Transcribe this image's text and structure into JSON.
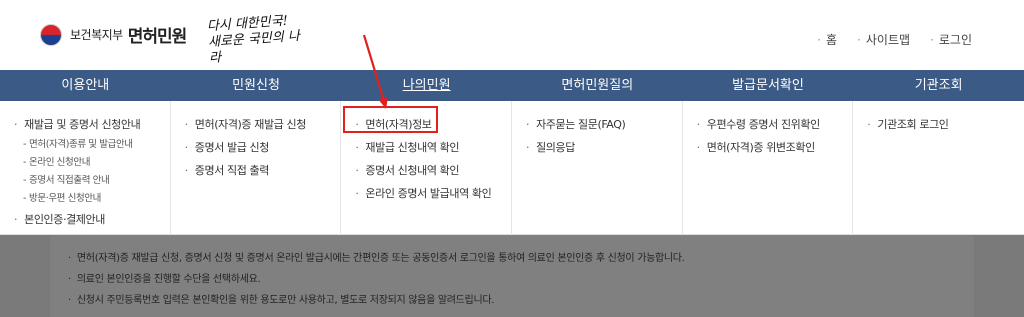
{
  "header": {
    "ministry": "보건복지부",
    "site_name": "면허민원",
    "slogan_line1": "다시 대한민국!",
    "slogan_line2": "새로운 국민의 나라",
    "topnav": [
      "홈",
      "사이트맵",
      "로그인"
    ]
  },
  "gnb": [
    "이용안내",
    "민원신청",
    "나의민원",
    "면허민원질의",
    "발급문서확인",
    "기관조회"
  ],
  "menu": {
    "col1": {
      "item1": "재발급 및 증명서 신청안내",
      "subs": [
        "면허(자격)종류 및 발급안내",
        "온라인 신청안내",
        "증명서 직접출력 안내",
        "방문·우편 신청안내"
      ],
      "item2": "본인인증·결제안내"
    },
    "col2": [
      "면허(자격)증 재발급 신청",
      "증명서 발급 신청",
      "증명서 직접 출력"
    ],
    "col3": [
      "면허(자격)정보",
      "재발급 신청내역 확인",
      "증명서 신청내역 확인",
      "온라인 증명서 발급내역 확인"
    ],
    "col4": [
      "자주묻는 질문(FAQ)",
      "질의응답"
    ],
    "col5": [
      "우편수령 증명서 진위확인",
      "면허(자격)증 위변조확인"
    ],
    "col6": [
      "기관조회 로그인"
    ]
  },
  "notice": [
    "면허(자격)증 재발급 신청, 증명서 신청 및 증명서 온라인 발급시에는 간편인증 또는 공동인증서 로그인을 통하여 의료인 본인인증 후 신청이 가능합니다.",
    "의료인 본인인증을 진행할 수단을 선택하세요.",
    "신청시 주민등록번호 입력은 본인확인을 위한 용도로만 사용하고, 별도로 저장되지 않음을 알려드립니다."
  ],
  "colors": {
    "gnb_bg": "#3b5a86",
    "highlight": "#e0221f"
  }
}
